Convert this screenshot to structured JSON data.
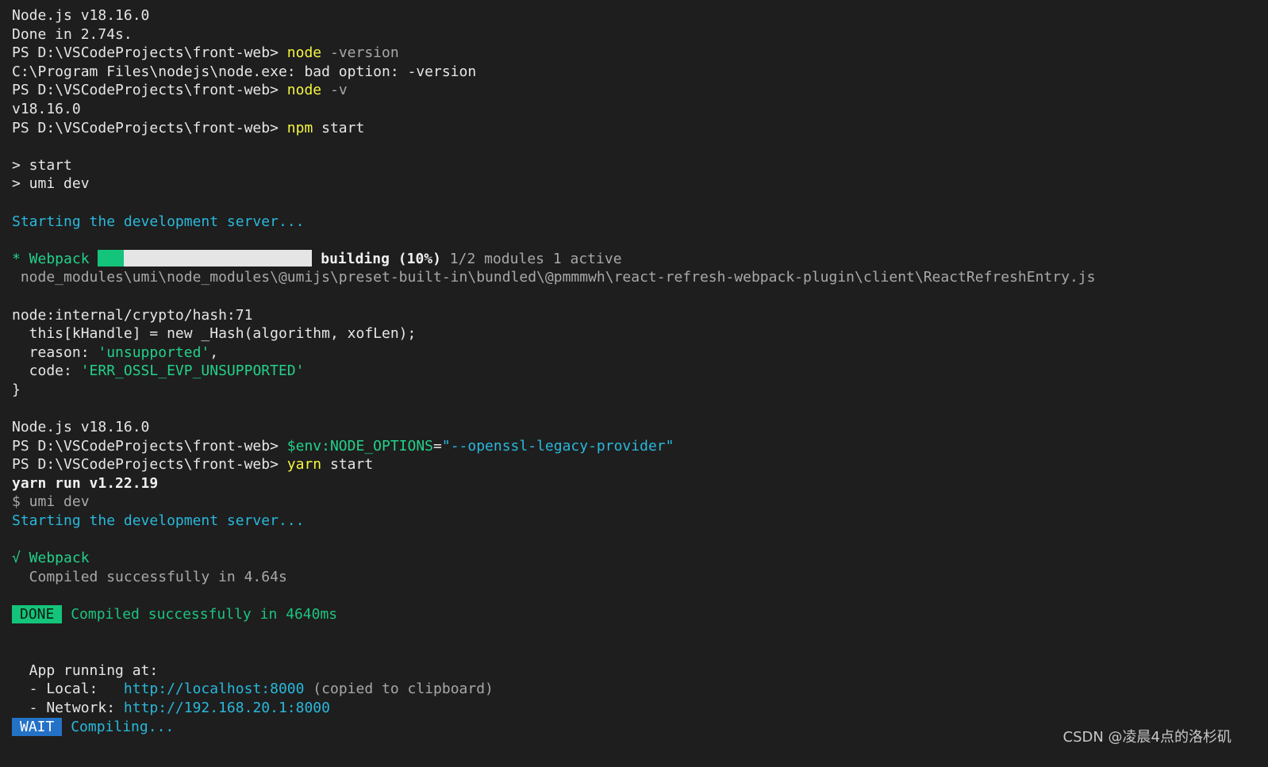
{
  "terminal": {
    "prompt": "PS D:\\VSCodeProjects\\front-web> ",
    "lines": {
      "l1": "Node.js v18.16.0",
      "l2": "Done in 2.74s.",
      "l3_cmd": "node",
      "l3_arg": " -version",
      "l4": "C:\\Program Files\\nodejs\\node.exe: bad option: -version",
      "l5_cmd": "node",
      "l5_arg": " -v",
      "l6": "v18.16.0",
      "l7_cmd": "npm",
      "l7_arg": " start",
      "l9": "> start",
      "l10": "> umi dev",
      "l12": "Starting the development server...",
      "l14_label": "* Webpack",
      "l14_status": "building (10%)",
      "l14_detail": " 1/2 modules 1 active",
      "l15": " node_modules\\umi\\node_modules\\@umijs\\preset-built-in\\bundled\\@pmmmwh\\react-refresh-webpack-plugin\\client\\ReactRefreshEntry.js",
      "l17": "node:internal/crypto/hash:71",
      "l18": "  this[kHandle] = new _Hash(algorithm, xofLen);",
      "l19_key": "  reason: ",
      "l19_val": "'unsupported'",
      "l19_end": ",",
      "l20_key": "  code: ",
      "l20_val": "'ERR_OSSL_EVP_UNSUPPORTED'",
      "l21": "}",
      "l23": "Node.js v18.16.0",
      "l24_var": "$env:NODE_OPTIONS",
      "l24_eq": "=",
      "l24_val": "\"--openssl-legacy-provider\"",
      "l25_cmd": "yarn",
      "l25_arg": " start",
      "l26": "yarn run v1.22.19",
      "l27": "$ umi dev",
      "l28": "Starting the development server...",
      "l30": "√ Webpack",
      "l31": "  Compiled successfully in 4.64s",
      "l33_badge": "DONE",
      "l33_msg": " Compiled successfully in 4640ms",
      "l36": "  App running at:",
      "l37_label": "  - Local:   ",
      "l37_url": "http://localhost:8000",
      "l37_note": " (copied to clipboard)",
      "l38_label": "  - Network: ",
      "l38_url": "http://192.168.20.1:8000",
      "l39_badge": "WAIT",
      "l39_msg": " Compiling..."
    },
    "progress_fraction": 0.12
  },
  "watermark": "CSDN @凌晨4点的洛杉矶",
  "colors": {
    "background": "#1e1e1e",
    "foreground": "#cccccc",
    "command": "#f5f543",
    "info": "#29b8db",
    "success": "#23d18b",
    "dim": "#a8a8a8",
    "wait_badge": "#2472c8"
  }
}
